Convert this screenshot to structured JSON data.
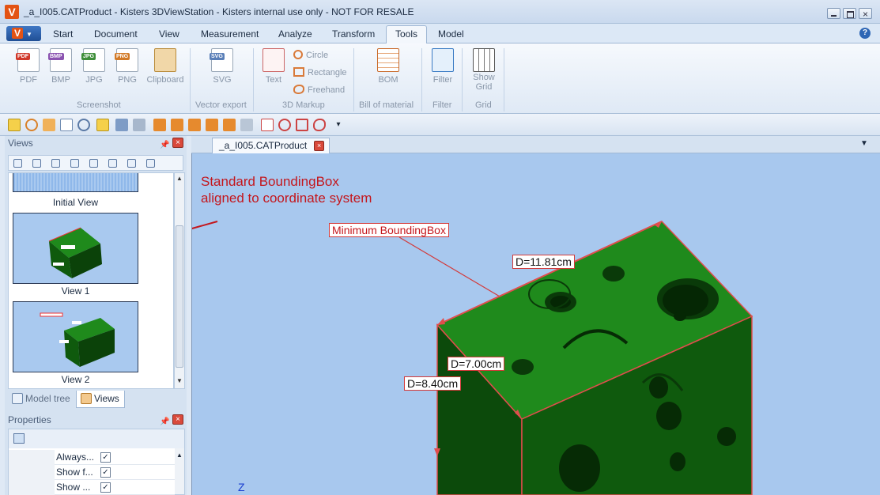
{
  "window": {
    "title": "_a_I005.CATProduct - Kisters 3DViewStation - Kisters internal use only - NOT FOR RESALE",
    "logo_letter": "V"
  },
  "ribbon": {
    "app_menu": "V",
    "tabs": [
      "Start",
      "Document",
      "View",
      "Measurement",
      "Analyze",
      "Transform",
      "Tools",
      "Model"
    ],
    "active_tab": "Tools",
    "groups": {
      "screenshot": {
        "label": "Screenshot",
        "buttons": [
          "PDF",
          "BMP",
          "JPG",
          "PNG",
          "Clipboard"
        ],
        "badges": [
          "PDF",
          "BMP",
          "JPG",
          "PNG"
        ]
      },
      "vector_export": {
        "label": "Vector export",
        "button": "SVG",
        "badge": "SVG"
      },
      "markup": {
        "label": "3D Markup",
        "text_button": "Text",
        "circle": "Circle",
        "rectangle": "Rectangle",
        "freehand": "Freehand"
      },
      "bom": {
        "label": "Bill of material",
        "button": "BOM"
      },
      "filter": {
        "label": "Filter",
        "button": "Filter"
      },
      "grid": {
        "label": "Grid",
        "button_line1": "Show",
        "button_line2": "Grid"
      }
    }
  },
  "left_panel": {
    "views_title": "Views",
    "views": [
      {
        "label": "Initial View"
      },
      {
        "label": "View 1"
      },
      {
        "label": "View 2"
      }
    ],
    "bottom_tabs": [
      "Model tree",
      "Views"
    ],
    "active_bottom_tab": "Views",
    "properties_title": "Properties",
    "properties": [
      {
        "name": "Always...",
        "checked": "✓"
      },
      {
        "name": "Show f...",
        "checked": "✓"
      },
      {
        "name": "Show ...",
        "checked": "✓"
      }
    ]
  },
  "document": {
    "tab_label": "_a_I005.CATProduct"
  },
  "viewport": {
    "annotation_line1": "Standard BoundingBox",
    "annotation_line2": "aligned to coordinate system",
    "min_bbox_label": "Minimum BoundingBox",
    "dims": [
      "D=11.81cm",
      "D=7.00cm",
      "D=8.40cm"
    ],
    "axis_label": "Z",
    "colors": {
      "background": "#a8c8ee",
      "part_top": "#1f8a1c",
      "part_front": "#0f5a0d",
      "part_side": "#0b4209",
      "annotation": "#c4161c"
    }
  }
}
